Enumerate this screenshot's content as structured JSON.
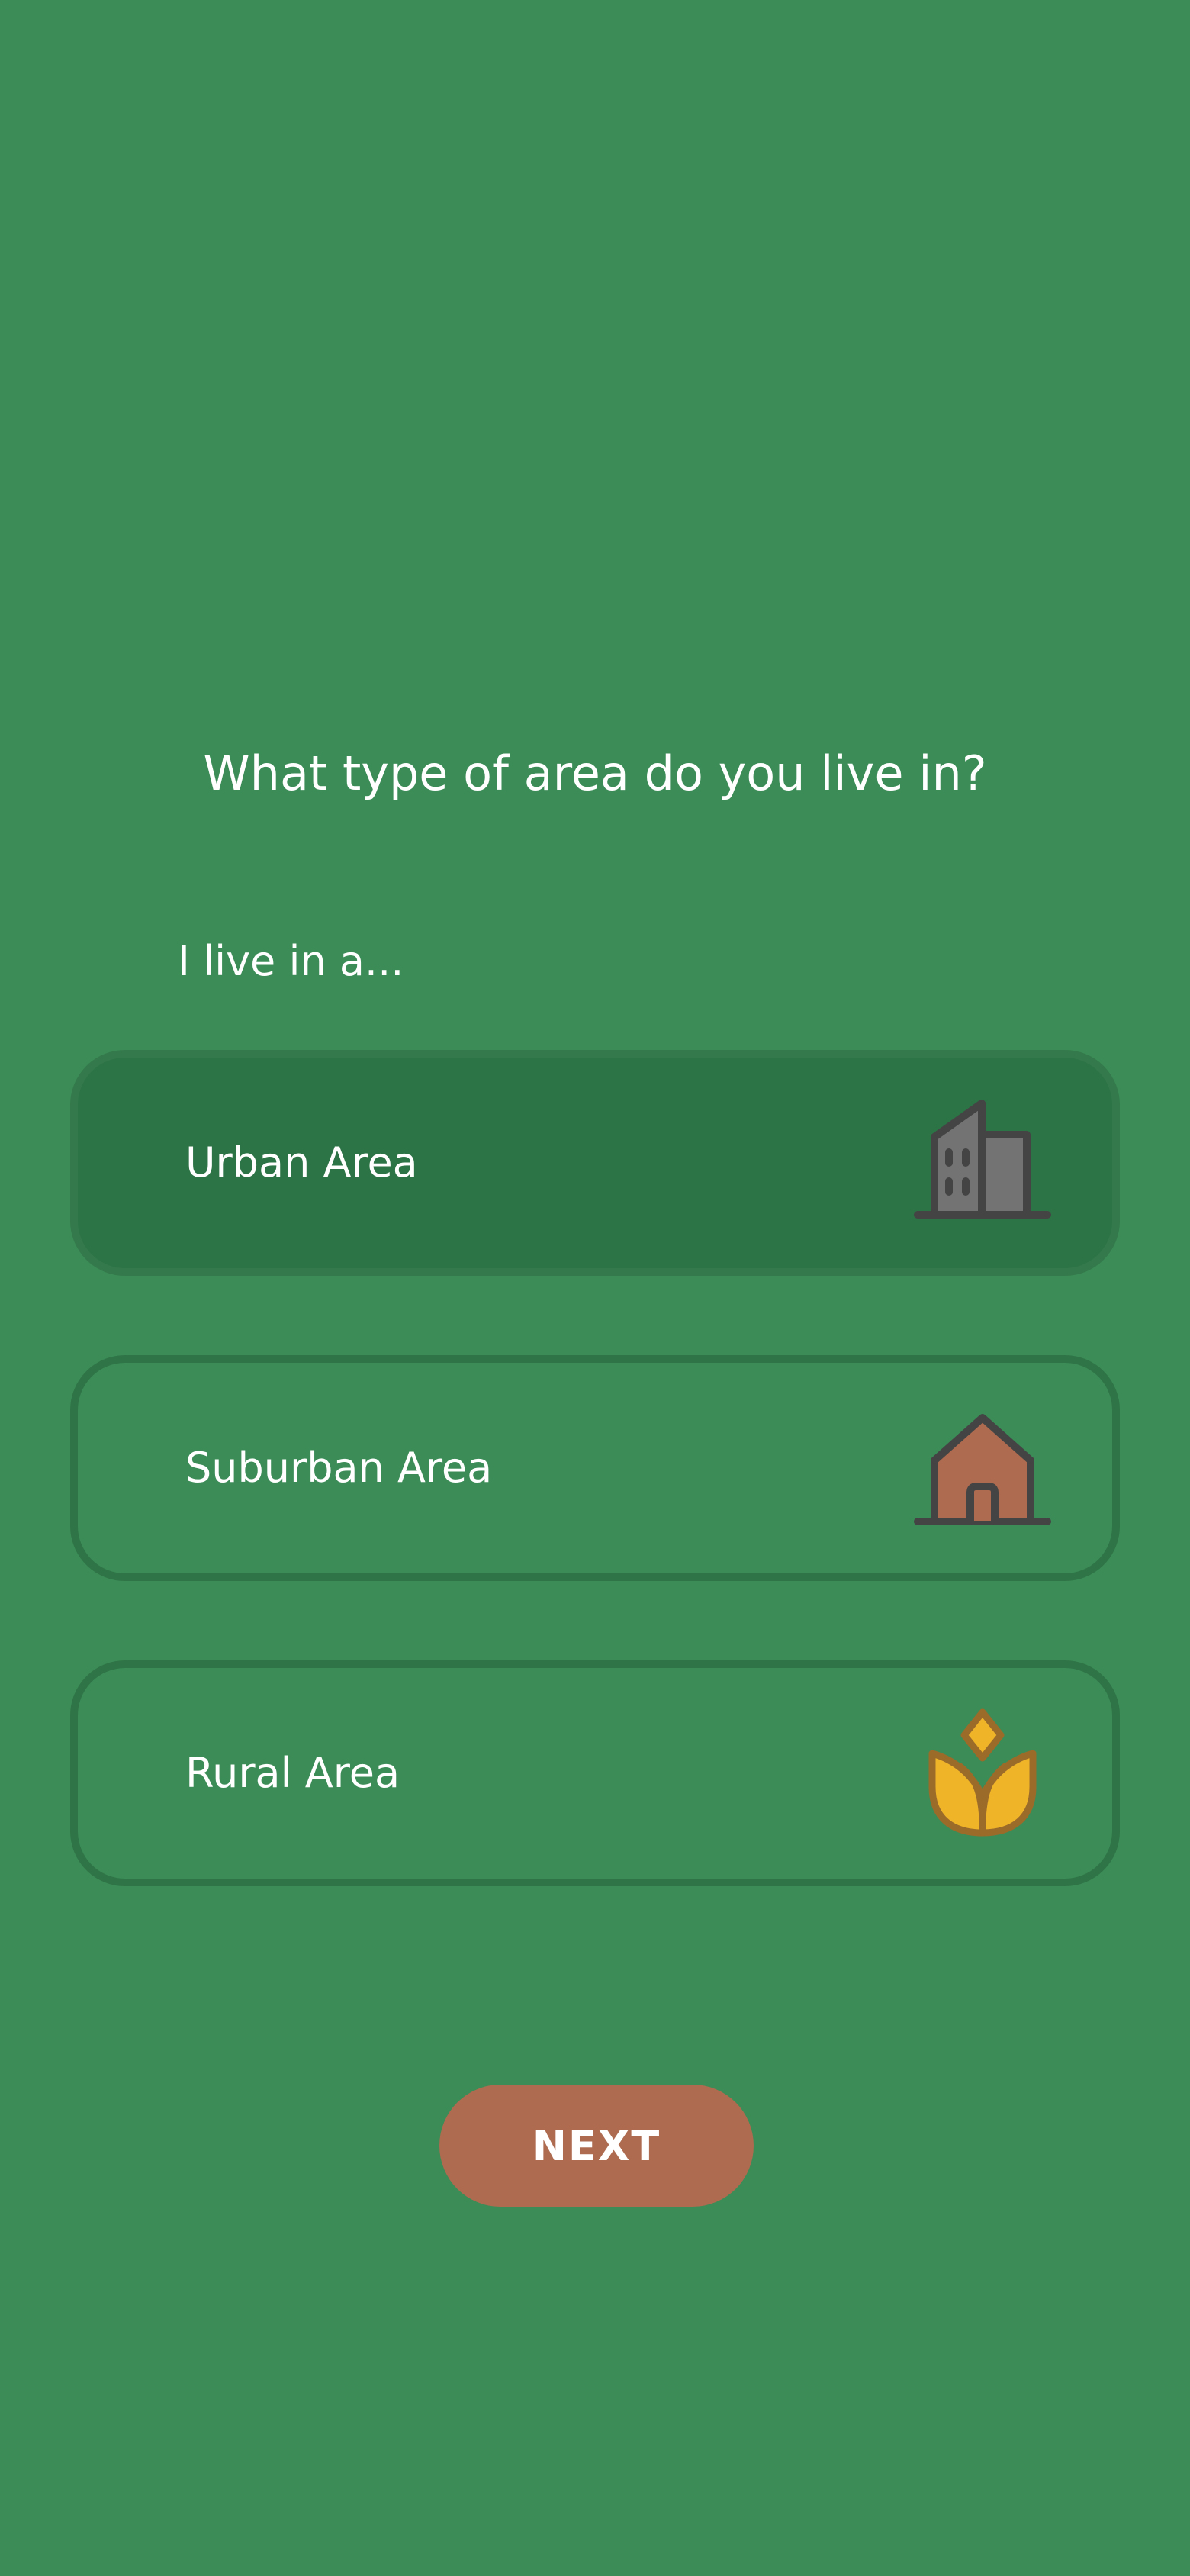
{
  "question": "What type of area do you live in?",
  "prompt": "I live in a...",
  "options": [
    {
      "label": "Urban Area",
      "icon": "city-building-icon",
      "selected": true
    },
    {
      "label": "Suburban Area",
      "icon": "house-icon",
      "selected": false
    },
    {
      "label": "Rural Area",
      "icon": "wheat-icon",
      "selected": false
    }
  ],
  "next_button": "NEXT",
  "colors": {
    "background": "#3b8c57",
    "selected_option": "#2c7346",
    "option_border": "#2f7446",
    "button": "#ae6b50",
    "text": "#ffffff"
  }
}
